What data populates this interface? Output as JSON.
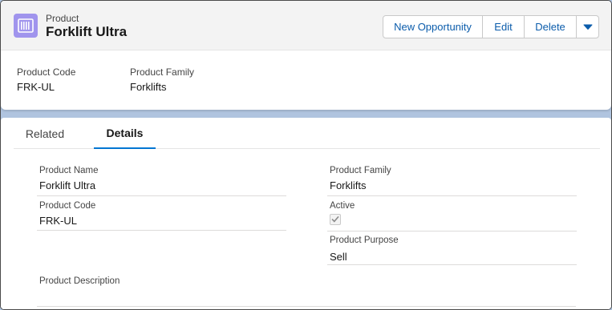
{
  "header": {
    "object_label": "Product",
    "record_title": "Forklift Ultra",
    "icon": "product-icon",
    "icon_color": "#a094ed",
    "actions": {
      "new_opportunity": "New Opportunity",
      "edit": "Edit",
      "delete": "Delete",
      "more_icon": "chevron-down-icon"
    }
  },
  "highlights": [
    {
      "label": "Product Code",
      "value": "FRK-UL"
    },
    {
      "label": "Product Family",
      "value": "Forklifts"
    }
  ],
  "tabs": [
    {
      "label": "Related",
      "active": false
    },
    {
      "label": "Details",
      "active": true
    }
  ],
  "details": {
    "product_name": {
      "label": "Product Name",
      "value": "Forklift Ultra"
    },
    "product_code": {
      "label": "Product Code",
      "value": "FRK-UL"
    },
    "product_family": {
      "label": "Product Family",
      "value": "Forklifts"
    },
    "active": {
      "label": "Active",
      "checked": true
    },
    "product_purpose": {
      "label": "Product Purpose",
      "value": "Sell"
    },
    "product_description": {
      "label": "Product Description",
      "value": ""
    }
  },
  "colors": {
    "accent": "#0176d3",
    "link": "#0b5cab",
    "page_background": "#b0c4df"
  }
}
